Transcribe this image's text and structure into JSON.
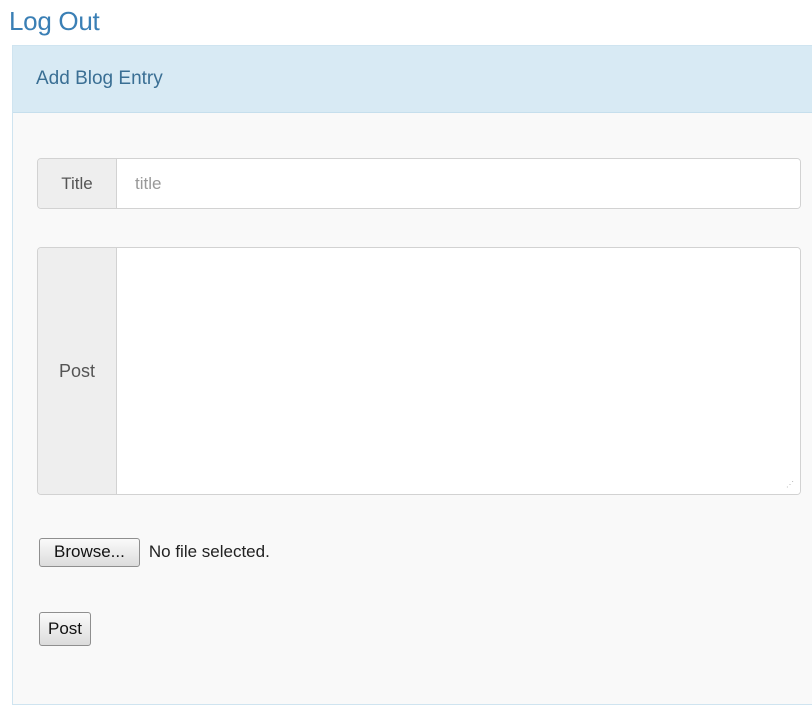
{
  "header": {
    "logout_label": "Log Out"
  },
  "panel": {
    "title": "Add Blog Entry",
    "title_field": {
      "label": "Title",
      "placeholder": "title",
      "value": ""
    },
    "post_field": {
      "label": "Post",
      "value": ""
    },
    "file_input": {
      "button_label": "Browse...",
      "status": "No file selected."
    },
    "submit_label": "Post"
  },
  "colors": {
    "link": "#3a7fb5",
    "panel_heading_bg": "#d8eaf4",
    "panel_title": "#3a6f94",
    "addon_bg": "#eeeeee"
  }
}
